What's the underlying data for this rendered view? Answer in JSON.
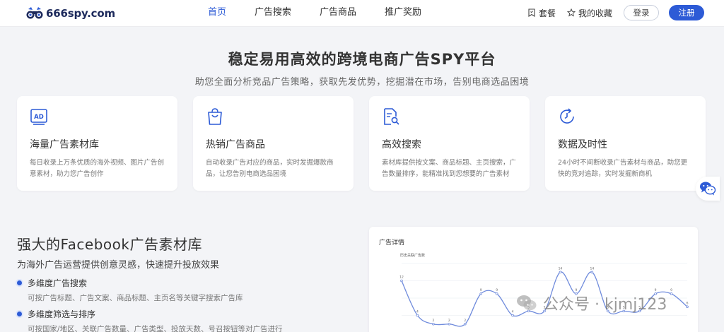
{
  "header": {
    "logo_text": "666spy.com",
    "nav": [
      {
        "label": "首页",
        "active": true
      },
      {
        "label": "广告搜索",
        "active": false
      },
      {
        "label": "广告商品",
        "active": false
      },
      {
        "label": "推广奖励",
        "active": false
      }
    ],
    "plan_label": "套餐",
    "favorites_label": "我的收藏",
    "login_label": "登录",
    "register_label": "注册"
  },
  "hero": {
    "title": "稳定易用高效的跨境电商广告SPY平台",
    "subtitle": "助您全面分析竞品广告策略，获取先发优势，挖掘潜在市场，告别电商选品困境"
  },
  "cards": [
    {
      "icon": "ad-icon",
      "title": "海量广告素材库",
      "desc": "每日收录上万条优质的海外视频、图片广告创意素材，助力您广告创作"
    },
    {
      "icon": "shopping-bag-icon",
      "title": "热销广告商品",
      "desc": "自动收录广告对应的商品，实时发掘爆款商品，让您告别电商选品困境"
    },
    {
      "icon": "document-search-icon",
      "title": "高效搜索",
      "desc": "素材库提供按文案、商品标题、主页搜索，广告数量排序，能精准找到您想要的广告素材"
    },
    {
      "icon": "refresh-clock-icon",
      "title": "数据及时性",
      "desc": "24小时不间断收录广告素材与商品，助您更快的竞对追踪，实时发掘新商机"
    }
  ],
  "library": {
    "title": "强大的Facebook广告素材库",
    "subtitle": "为海外广告运营提供创意灵感，快速提升投放效果",
    "features": [
      {
        "title": "多维度广告搜索",
        "desc": "可按广告标题、广告文案、商品标题、主页名等关键字搜索广告库"
      },
      {
        "title": "多维度筛选与排序",
        "desc": "可按国家/地区、关联广告数量、广告类型、投放天数、号召按钮等对广告进行"
      }
    ]
  },
  "panel": {
    "title": "广告详情",
    "chart_subtitle": "历史关联广告数"
  },
  "chart_data": {
    "type": "line",
    "title": "历史关联广告数",
    "xlabel": "",
    "ylabel": "",
    "series": [
      {
        "values": [
          12,
          4,
          2,
          2,
          2,
          9,
          9,
          4,
          5,
          5,
          14,
          9,
          14,
          5,
          5,
          5,
          9,
          9,
          6
        ]
      }
    ],
    "ylim": [
      0,
      16
    ],
    "grid": true,
    "line_color": "#6f8bdc"
  },
  "watermark": {
    "text": "公众号 · kjmj123"
  }
}
